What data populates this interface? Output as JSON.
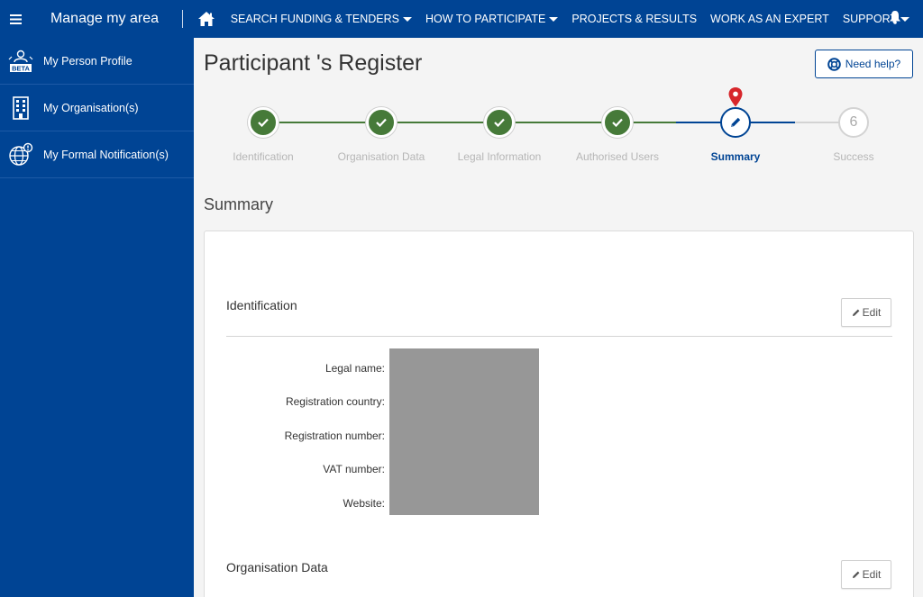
{
  "topbar": {
    "title": "Manage my area",
    "nav": [
      {
        "label": "SEARCH FUNDING & TENDERS",
        "dropdown": true
      },
      {
        "label": "HOW TO PARTICIPATE",
        "dropdown": true
      },
      {
        "label": "PROJECTS & RESULTS",
        "dropdown": false
      },
      {
        "label": "WORK AS AN EXPERT",
        "dropdown": false
      },
      {
        "label": "SUPPORT",
        "dropdown": true
      }
    ],
    "icons": {
      "menu": "hamburger-menu-icon",
      "home": "home-icon",
      "bell": "bell-icon"
    }
  },
  "sidebar": {
    "items": [
      {
        "label": "My Person Profile",
        "icon": "beta-profile-icon",
        "icon_text": "BETA"
      },
      {
        "label": "My Organisation(s)",
        "icon": "building-icon"
      },
      {
        "label": "My Formal Notification(s)",
        "icon": "globe-notification-icon"
      }
    ]
  },
  "page": {
    "title": "Participant 's Register",
    "help_label": "Need help?",
    "section_title": "Summary"
  },
  "stepper": {
    "steps": [
      {
        "label": "Identification",
        "state": "done"
      },
      {
        "label": "Organisation Data",
        "state": "done"
      },
      {
        "label": "Legal Information",
        "state": "done"
      },
      {
        "label": "Authorised Users",
        "state": "done"
      },
      {
        "label": "Summary",
        "state": "current"
      },
      {
        "label": "Success",
        "state": "future",
        "number": "6"
      }
    ]
  },
  "summary": {
    "identification": {
      "heading": "Identification",
      "edit_label": "Edit",
      "fields": [
        "Legal name:",
        "Registration country:",
        "Registration number:",
        "VAT number:",
        "Website:"
      ]
    },
    "organisation_data": {
      "heading": "Organisation Data",
      "edit_label": "Edit"
    }
  },
  "colors": {
    "brand_blue": "#004494",
    "done_green": "#467a39",
    "pin_red": "#d7262b",
    "redaction_gray": "#979797"
  }
}
